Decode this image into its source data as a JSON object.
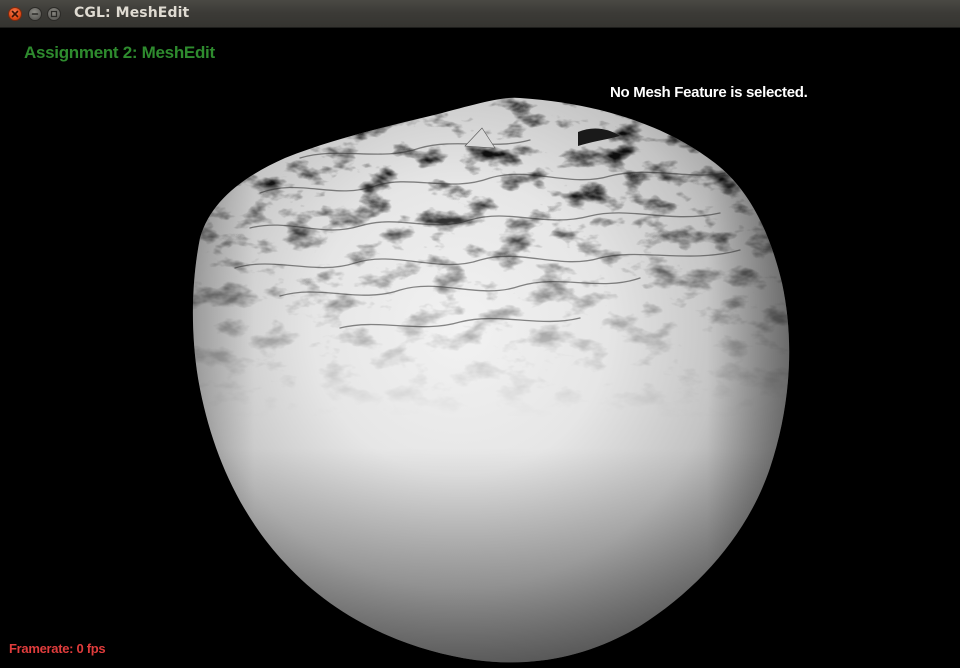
{
  "window": {
    "title": "CGL: MeshEdit",
    "controls": {
      "close_icon": "close-icon",
      "minimize_icon": "minimize-icon",
      "maximize_icon": "maximize-icon"
    }
  },
  "hud": {
    "assignment_title": "Assignment 2: MeshEdit",
    "selection_status": "No Mesh Feature is selected.",
    "framerate": "Framerate: 0 fps"
  },
  "colors": {
    "background": "#000000",
    "assignment_title": "#2e8b2e",
    "selection_status": "#ffffff",
    "framerate": "#e03c3c",
    "mesh_shading": "#ececec"
  }
}
